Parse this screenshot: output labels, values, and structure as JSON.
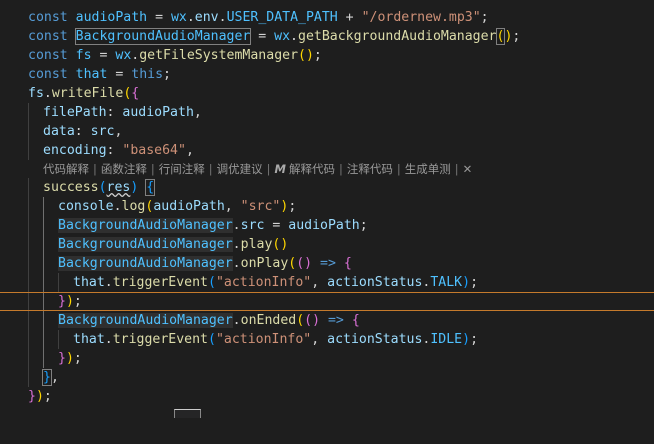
{
  "code": {
    "l1": {
      "kw": "const",
      "name": "audioPath",
      "eq": " = ",
      "obj": "wx",
      "dot1": ".",
      "env": "env",
      "dot2": ".",
      "const": "USER_DATA_PATH",
      "plus": " + ",
      "str": "\"/ordernew.mp3\"",
      "semi": ";"
    },
    "l2": {
      "kw": "const",
      "name": "BackgroundAudioManager",
      "eq": " = ",
      "obj": "wx",
      "dot": ".",
      "fn": "getBackgroundAudioManager",
      "open": "(",
      "close": ")",
      "semi": ";"
    },
    "l3": {
      "kw": "const",
      "name": "fs",
      "eq": " = ",
      "obj": "wx",
      "dot": ".",
      "fn": "getFileSystemManager",
      "open": "(",
      "close": ")",
      "semi": ";"
    },
    "l4": {
      "kw": "const",
      "name": "that",
      "eq": " = ",
      "this": "this",
      "semi": ";"
    },
    "l5": {
      "obj": "fs",
      "dot": ".",
      "fn": "writeFile",
      "paren": "(",
      "brace": "{"
    },
    "l6": {
      "prop": "filePath",
      "colon": ": ",
      "val": "audioPath",
      "comma": ","
    },
    "l7": {
      "prop": "data",
      "colon": ": ",
      "val": "src",
      "comma": ","
    },
    "l8": {
      "prop": "encoding",
      "colon": ": ",
      "str": "\"base64\"",
      "comma": ","
    },
    "l9": {
      "fn": "success",
      "open": "(",
      "param": "res",
      "close": ")",
      "sp": " ",
      "brace": "{"
    },
    "l10": {
      "obj": "console",
      "dot": ".",
      "fn": "log",
      "open": "(",
      "a1": "audioPath",
      "comma": ", ",
      "a2": "\"src\"",
      "close": ")",
      "semi": ";"
    },
    "l11": {
      "obj": "BackgroundAudioManager",
      "dot": ".",
      "prop": "src",
      "eq": " = ",
      "val": "audioPath",
      "semi": ";"
    },
    "l12": {
      "obj": "BackgroundAudioManager",
      "dot": ".",
      "fn": "play",
      "paren": "()"
    },
    "l13": {
      "obj": "BackgroundAudioManager",
      "dot": ".",
      "fn": "onPlay",
      "open": "(",
      "args": "()",
      "arrow": " => ",
      "brace": "{"
    },
    "l14": {
      "obj": "that",
      "dot": ".",
      "fn": "triggerEvent",
      "open": "(",
      "a1": "\"actionInfo\"",
      "comma": ", ",
      "a2obj": "actionStatus",
      "dot2": ".",
      "a2prop": "TALK",
      "close": ")",
      "semi": ";"
    },
    "l15": {
      "brace": "}",
      "close": ")",
      "semi": ";"
    },
    "l16": {
      "obj": "BackgroundAudioManager",
      "dot": ".",
      "fn": "onEnded",
      "open": "(",
      "args": "()",
      "arrow": " => ",
      "brace": "{"
    },
    "l17": {
      "obj": "that",
      "dot": ".",
      "fn": "triggerEvent",
      "open": "(",
      "a1": "\"actionInfo\"",
      "comma": ", ",
      "a2obj": "actionStatus",
      "dot2": ".",
      "a2prop": "IDLE",
      "close": ")",
      "semi": ";"
    },
    "l18": {
      "brace": "}",
      "close": ")",
      "semi": ";"
    },
    "l19": {
      "brace": "}",
      "comma": ","
    },
    "l20": {
      "brace": "}",
      "close": ")",
      "semi": ";"
    }
  },
  "codelens": {
    "items": [
      "代码解释",
      "函数注释",
      "行间注释",
      "调优建议",
      "解释代码",
      "注释代码",
      "生成单测"
    ],
    "separator": "|",
    "logo": "M",
    "close": "✕"
  },
  "colors": {
    "background": "#1e1e1e",
    "keyword": "#569cd6",
    "constant": "#4fc1ff",
    "function": "#dcdcaa",
    "string": "#ce9178",
    "property": "#9cdcfe",
    "bracket1": "#ffd700",
    "bracket2": "#da70d6",
    "bracket3": "#179fff",
    "accent_line": "#c57a2c"
  }
}
